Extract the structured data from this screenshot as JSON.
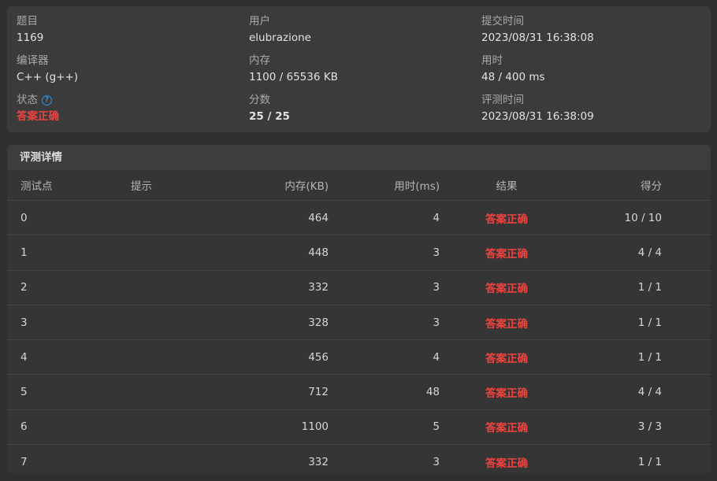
{
  "info": {
    "problem": {
      "label": "题目",
      "value": "1169"
    },
    "user": {
      "label": "用户",
      "value": "elubrazione"
    },
    "submit_time": {
      "label": "提交时间",
      "value": "2023/08/31 16:38:08"
    },
    "compiler": {
      "label": "编译器",
      "value": "C++ (g++)"
    },
    "memory": {
      "label": "内存",
      "value": "1100 / 65536 KB"
    },
    "time_used": {
      "label": "用时",
      "value": "48 / 400 ms"
    },
    "status": {
      "label": "状态",
      "help_icon": "question-circle-icon",
      "value": "答案正确"
    },
    "score": {
      "label": "分数",
      "value": "25 / 25"
    },
    "judge_time": {
      "label": "评测时间",
      "value": "2023/08/31 16:38:09"
    }
  },
  "details": {
    "title": "评测详情",
    "columns": {
      "id": "测试点",
      "hint": "提示",
      "memory": "内存(KB)",
      "time": "用时(ms)",
      "result": "结果",
      "score": "得分"
    },
    "rows": [
      {
        "id": "0",
        "hint": "",
        "memory": "464",
        "time": "4",
        "result": "答案正确",
        "score": "10 / 10"
      },
      {
        "id": "1",
        "hint": "",
        "memory": "448",
        "time": "3",
        "result": "答案正确",
        "score": "4 / 4"
      },
      {
        "id": "2",
        "hint": "",
        "memory": "332",
        "time": "3",
        "result": "答案正确",
        "score": "1 / 1"
      },
      {
        "id": "3",
        "hint": "",
        "memory": "328",
        "time": "3",
        "result": "答案正确",
        "score": "1 / 1"
      },
      {
        "id": "4",
        "hint": "",
        "memory": "456",
        "time": "4",
        "result": "答案正确",
        "score": "1 / 1"
      },
      {
        "id": "5",
        "hint": "",
        "memory": "712",
        "time": "48",
        "result": "答案正确",
        "score": "4 / 4"
      },
      {
        "id": "6",
        "hint": "",
        "memory": "1100",
        "time": "5",
        "result": "答案正确",
        "score": "3 / 3"
      },
      {
        "id": "7",
        "hint": "",
        "memory": "332",
        "time": "3",
        "result": "答案正确",
        "score": "1 / 1"
      }
    ]
  },
  "colors": {
    "background": "#2f2f2f",
    "card": "#3b3b3b",
    "accepted": "#f0433f",
    "help_icon": "#2f95e8"
  }
}
